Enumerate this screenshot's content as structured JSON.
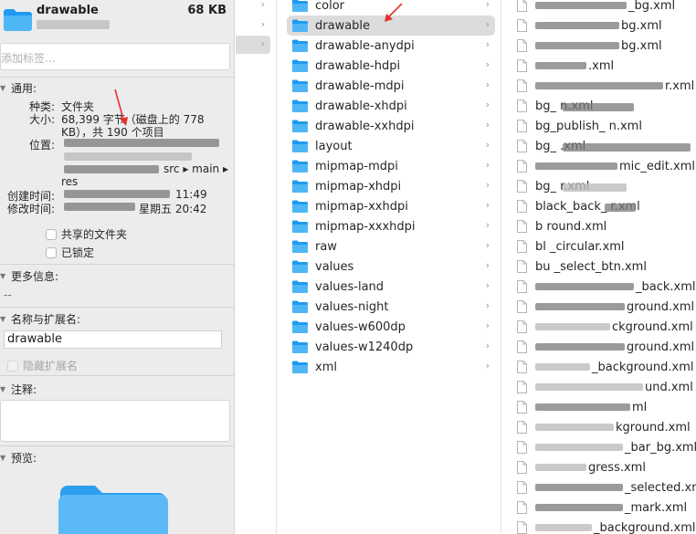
{
  "info": {
    "name": "drawable",
    "size": "68 KB",
    "tags_placeholder": "添加标签...",
    "general": {
      "heading": "通用:",
      "kind_key": "种类:",
      "kind_val": "文件夹",
      "size_key": "大小:",
      "size_val_1": "68,399 字节（磁盘上的 778",
      "size_val_2": "KB），共 190 个项目",
      "where_key": "位置:",
      "where_val_3": "src ▸ main ▸",
      "where_val_4": "res",
      "created_key": "创建时间:",
      "created_val": "11:49",
      "modified_key": "修改时间:",
      "modified_val": "星期五 20:42",
      "shared_label": "共享的文件夹",
      "locked_label": "已锁定"
    },
    "more_info": {
      "heading": "更多信息:",
      "value": "--"
    },
    "name_ext": {
      "heading": "名称与扩展名:",
      "value": "drawable",
      "hide_ext_label": "隐藏扩展名"
    },
    "comments": {
      "heading": "注释:"
    },
    "preview": {
      "heading": "预览:"
    }
  },
  "folders": [
    {
      "label": "color"
    },
    {
      "label": "drawable"
    },
    {
      "label": "drawable-anydpi"
    },
    {
      "label": "drawable-hdpi"
    },
    {
      "label": "drawable-mdpi"
    },
    {
      "label": "drawable-xhdpi"
    },
    {
      "label": "drawable-xxhdpi"
    },
    {
      "label": "layout"
    },
    {
      "label": "mipmap-mdpi"
    },
    {
      "label": "mipmap-xhdpi"
    },
    {
      "label": "mipmap-xxhdpi"
    },
    {
      "label": "mipmap-xxxhdpi"
    },
    {
      "label": "raw"
    },
    {
      "label": "values"
    },
    {
      "label": "values-land"
    },
    {
      "label": "values-night"
    },
    {
      "label": "values-w600dp"
    },
    {
      "label": "values-w1240dp"
    },
    {
      "label": "xml"
    }
  ],
  "files": [
    {
      "label": "_bg.xml"
    },
    {
      "label": "bg.xml"
    },
    {
      "label": "bg.xml"
    },
    {
      "label": ".xml"
    },
    {
      "label": "r.xml"
    },
    {
      "label": "bg_ n.xml"
    },
    {
      "label": "bg_publish_ n.xml"
    },
    {
      "label": "bg_ .xml"
    },
    {
      "label": "mic_edit.xml"
    },
    {
      "label": "bg_ r.xml"
    },
    {
      "label": "black_back_ r.xml"
    },
    {
      "label": "b round.xml"
    },
    {
      "label": "bl _circular.xml"
    },
    {
      "label": "bu _select_btn.xml"
    },
    {
      "label": "_back.xml"
    },
    {
      "label": "ground.xml"
    },
    {
      "label": "ckground.xml"
    },
    {
      "label": "ground.xml"
    },
    {
      "label": "_background.xml"
    },
    {
      "label": "und.xml"
    },
    {
      "label": "ml"
    },
    {
      "label": "kground.xml"
    },
    {
      "label": "_bar_bg.xml"
    },
    {
      "label": "gress.xml"
    },
    {
      "label": "_selected.xml"
    },
    {
      "label": "_mark.xml"
    },
    {
      "label": "_background.xml"
    }
  ],
  "colors": {
    "folder_blue": "#1e9bf0",
    "accent_arrow": "#e5322d",
    "selection": "#dcdcdc"
  }
}
